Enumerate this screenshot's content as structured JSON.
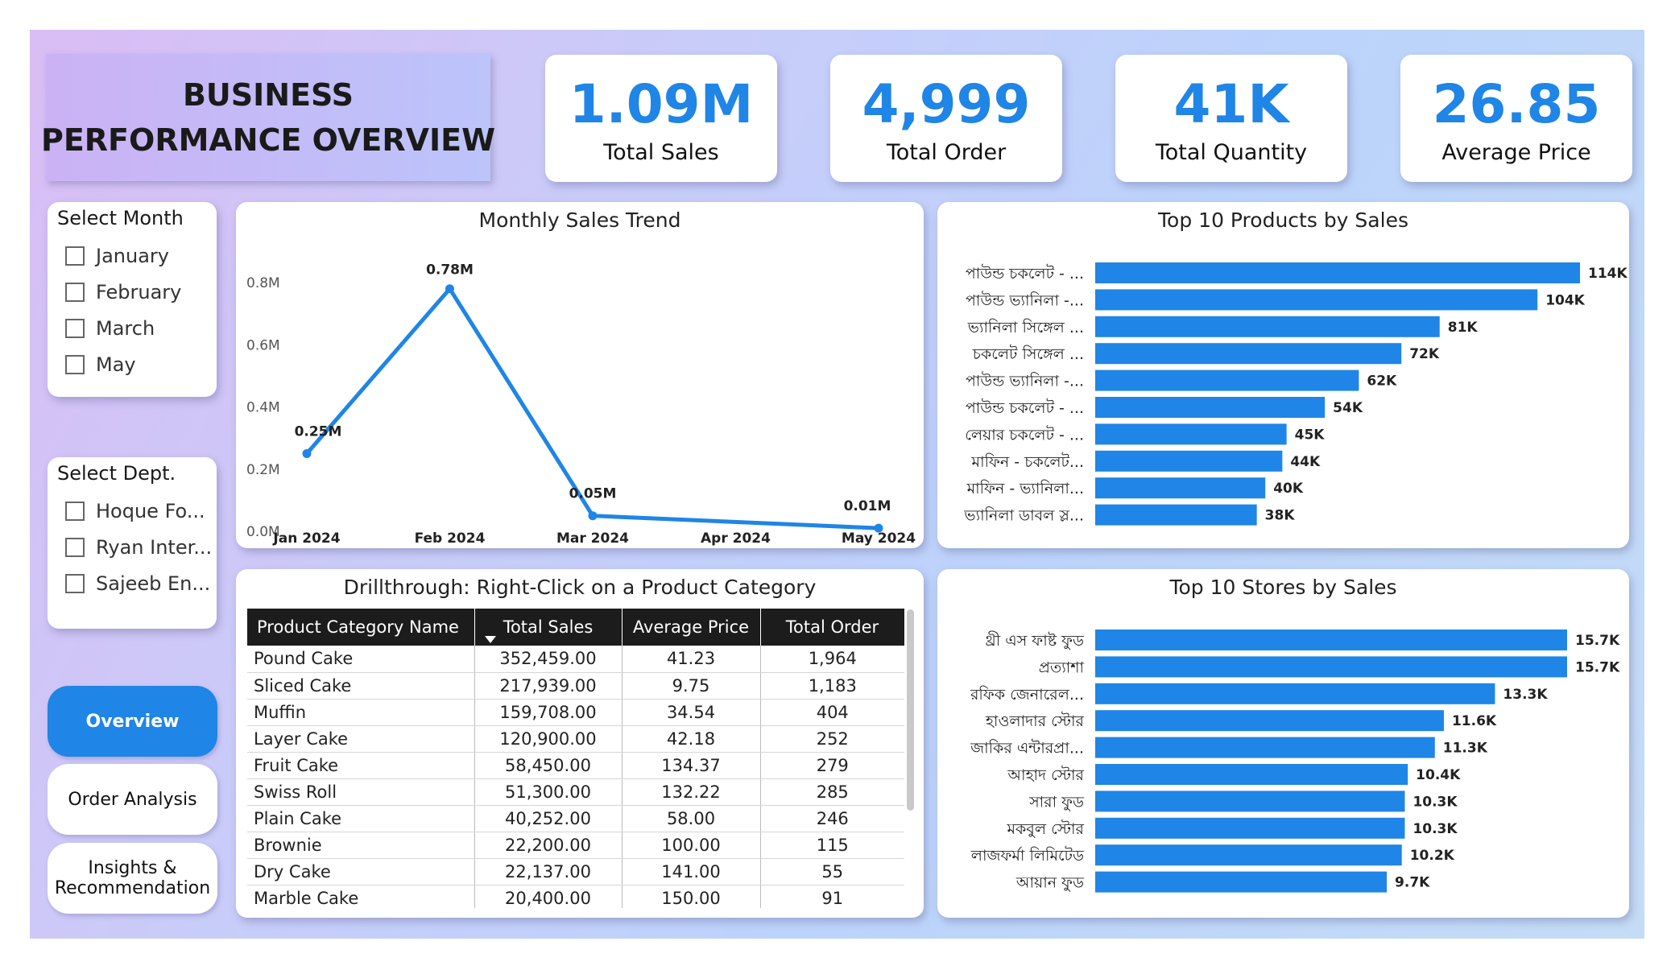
{
  "title": {
    "line1": "BUSINESS",
    "line2": "PERFORMANCE OVERVIEW"
  },
  "kpis": [
    {
      "value": "1.09M",
      "label": "Total Sales"
    },
    {
      "value": "4,999",
      "label": "Total Order"
    },
    {
      "value": "41K",
      "label": "Total Quantity"
    },
    {
      "value": "26.85",
      "label": "Average Price"
    }
  ],
  "month_slicer": {
    "title": "Select Month",
    "options": [
      "January",
      "February",
      "March",
      "May"
    ]
  },
  "dept_slicer": {
    "title": "Select Dept.",
    "options": [
      "Hoque Fo...",
      "Ryan Inter...",
      "Sajeeb En..."
    ]
  },
  "nav": {
    "overview": "Overview",
    "order_analysis": "Order Analysis",
    "insights_line1": "Insights &",
    "insights_line2": "Recommendation"
  },
  "colors": {
    "accent": "#1f85e6",
    "header": "#1c1c1c"
  },
  "chart_data": [
    {
      "type": "line",
      "title": "Monthly Sales Trend",
      "x": [
        "Jan 2024",
        "Feb 2024",
        "Mar 2024",
        "Apr 2024",
        "May 2024"
      ],
      "points": [
        {
          "x": "Jan 2024",
          "y": 0.25,
          "label": "0.25M"
        },
        {
          "x": "Feb 2024",
          "y": 0.78,
          "label": "0.78M"
        },
        {
          "x": "Mar 2024",
          "y": 0.05,
          "label": "0.05M"
        },
        {
          "x": "May 2024",
          "y": 0.01,
          "label": "0.01M"
        }
      ],
      "yticks": [
        "0.0M",
        "0.2M",
        "0.4M",
        "0.6M",
        "0.8M"
      ],
      "ylim": [
        0,
        0.8
      ],
      "grid": false
    },
    {
      "type": "bar",
      "orientation": "horizontal",
      "title": "Top 10 Products by Sales",
      "categories": [
        "পাউন্ড চকলেট - ...",
        "পাউন্ড ভ্যানিলা -...",
        "ভ্যানিলা সিঙ্গেল ...",
        "চকলেট সিঙ্গেল ...",
        "পাউন্ড ভ্যানিলা -...",
        "পাউন্ড চকলেট - ...",
        "লেয়ার চকলেট - ...",
        "মাফিন - চকলেট...",
        "মাফিন - ভ্যানিলা...",
        "ভ্যানিলা ডাবল স্ল..."
      ],
      "values": [
        114,
        104,
        81,
        72,
        62,
        54,
        45,
        44,
        40,
        38
      ],
      "labels": [
        "114K",
        "104K",
        "81K",
        "72K",
        "62K",
        "54K",
        "45K",
        "44K",
        "40K",
        "38K"
      ]
    },
    {
      "type": "bar",
      "orientation": "horizontal",
      "title": "Top 10 Stores by Sales",
      "categories": [
        "থ্রী এস ফাষ্ট ফুড",
        "প্রত্যাশা",
        "রফিক জেনারেল...",
        "হাওলাদার স্টোর",
        "জাকির এন্টারপ্রা...",
        "আহাদ স্টোর",
        "সারা ফুড",
        "মকবুল স্টোর",
        "লাজফর্মা লিমিটেড",
        "আয়ান ফুড"
      ],
      "values": [
        15.7,
        15.7,
        13.3,
        11.6,
        11.3,
        10.4,
        10.3,
        10.3,
        10.2,
        9.7
      ],
      "labels": [
        "15.7K",
        "15.7K",
        "13.3K",
        "11.6K",
        "11.3K",
        "10.4K",
        "10.3K",
        "10.3K",
        "10.2K",
        "9.7K"
      ]
    }
  ],
  "drillthrough": {
    "title": "Drillthrough: Right-Click on a Product Category",
    "columns": [
      "Product Category Name",
      "Total Sales",
      "Average Price",
      "Total Order"
    ],
    "rows": [
      [
        "Pound Cake",
        "352,459.00",
        "41.23",
        "1,964"
      ],
      [
        "Sliced Cake",
        "217,939.00",
        "9.75",
        "1,183"
      ],
      [
        "Muffin",
        "159,708.00",
        "34.54",
        "404"
      ],
      [
        "Layer Cake",
        "120,900.00",
        "42.18",
        "252"
      ],
      [
        "Fruit Cake",
        "58,450.00",
        "134.37",
        "279"
      ],
      [
        "Swiss Roll",
        "51,300.00",
        "132.22",
        "285"
      ],
      [
        "Plain Cake",
        "40,252.00",
        "58.00",
        "246"
      ],
      [
        "Brownie",
        "22,200.00",
        "100.00",
        "115"
      ],
      [
        "Dry Cake",
        "22,137.00",
        "141.00",
        "55"
      ],
      [
        "Marble Cake",
        "20,400.00",
        "150.00",
        "91"
      ]
    ]
  }
}
